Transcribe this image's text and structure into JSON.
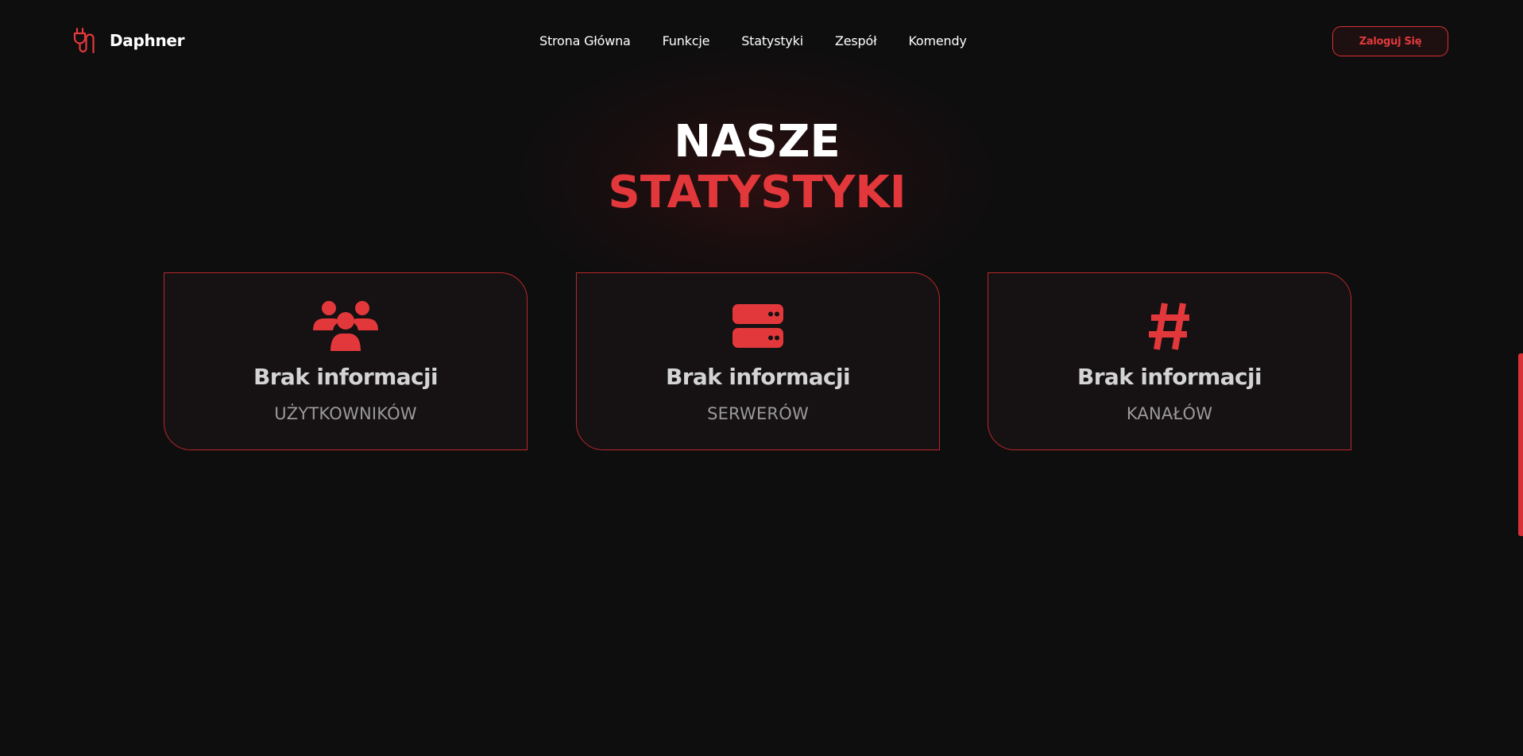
{
  "brand": {
    "name": "Daphner",
    "icon": "plug-icon"
  },
  "nav": {
    "items": [
      {
        "label": "Strona Główna"
      },
      {
        "label": "Funkcje"
      },
      {
        "label": "Statystyki"
      },
      {
        "label": "Zespół"
      },
      {
        "label": "Komendy"
      }
    ],
    "login_label": "Zaloguj Się"
  },
  "heading": {
    "line1": "NASZE",
    "line2": "STATYSTYKI"
  },
  "stats": [
    {
      "icon": "users-icon",
      "value": "Brak informacji",
      "label": "UŻYTKOWNIKÓW"
    },
    {
      "icon": "server-icon",
      "value": "Brak informacji",
      "label": "SERWERÓW"
    },
    {
      "icon": "hashtag-icon",
      "value": "Brak informacji",
      "label": "KANAŁÓW"
    }
  ],
  "colors": {
    "background": "#0e0e0f",
    "accent": "#e3383b",
    "card_background": "#161112",
    "text_primary": "#ffffff",
    "text_muted": "#9a9a9a"
  }
}
